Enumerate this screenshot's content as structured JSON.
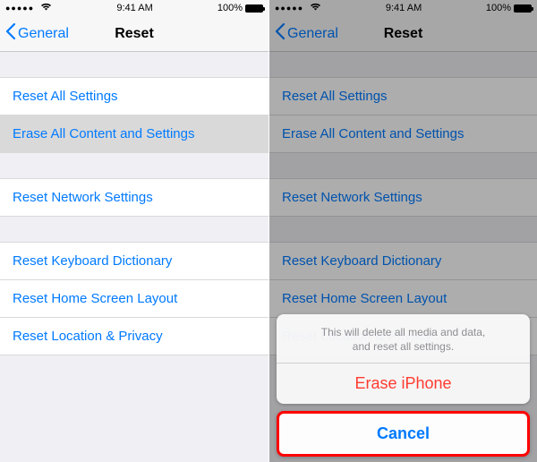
{
  "status": {
    "signal": "●●●●●",
    "time": "9:41 AM",
    "battery": "100%"
  },
  "nav": {
    "back": "General",
    "title": "Reset"
  },
  "groups": [
    {
      "items": [
        {
          "label": "Reset All Settings",
          "selected": false
        },
        {
          "label": "Erase All Content and Settings",
          "selected": true
        }
      ]
    },
    {
      "items": [
        {
          "label": "Reset Network Settings",
          "selected": false
        }
      ]
    },
    {
      "items": [
        {
          "label": "Reset Keyboard Dictionary",
          "selected": false
        },
        {
          "label": "Reset Home Screen Layout",
          "selected": false
        },
        {
          "label": "Reset Location & Privacy",
          "selected": false
        }
      ]
    }
  ],
  "sheet": {
    "message_line1": "This will delete all media and data,",
    "message_line2": "and reset all settings.",
    "action": "Erase iPhone",
    "cancel": "Cancel"
  }
}
